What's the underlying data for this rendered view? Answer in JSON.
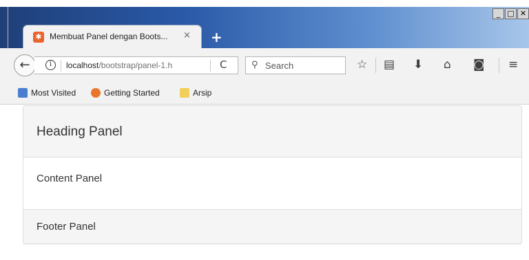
{
  "window": {
    "controls": {
      "minimize": "_",
      "maximize": "□",
      "close": "✕"
    }
  },
  "tab": {
    "title": "Membuat Panel dengan Boots...",
    "favicon": "xampp-icon",
    "close": "×",
    "new_tab": "+"
  },
  "navbar": {
    "back": "←",
    "info": "i",
    "url_host": "localhost",
    "url_path": "/bootstrap/panel-1.h",
    "reload": "C",
    "search_placeholder": "Search",
    "icons": [
      "bookmark-star-icon",
      "reading-list-icon",
      "download-icon",
      "home-icon",
      "pocket-icon",
      "menu-icon"
    ]
  },
  "bookmarks": {
    "items": [
      {
        "label": "Most Visited",
        "icon": "most-visited-icon",
        "color": "#4a7fd0"
      },
      {
        "label": "Getting Started",
        "icon": "firefox-icon",
        "color": "#e8762c"
      },
      {
        "label": "Arsip",
        "icon": "folder-icon",
        "color": "#f2cf5b"
      }
    ]
  },
  "panel": {
    "heading": "Heading Panel",
    "content": "Content Panel",
    "footer": "Footer Panel"
  },
  "colors": {
    "panel_bg": "#f5f5f5",
    "panel_border": "#dddddd",
    "text": "#333333"
  }
}
